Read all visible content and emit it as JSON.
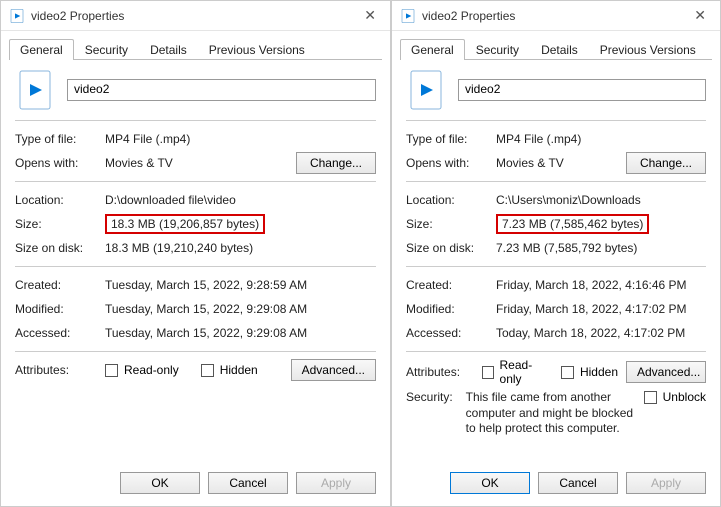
{
  "left": {
    "title": "video2 Properties",
    "tabs": [
      "General",
      "Security",
      "Details",
      "Previous Versions"
    ],
    "filename": "video2",
    "typeLbl": "Type of file:",
    "typeVal": "MP4 File (.mp4)",
    "opensLbl": "Opens with:",
    "opensVal": "Movies & TV",
    "changeBtn": "Change...",
    "locLbl": "Location:",
    "locVal": "D:\\downloaded file\\video",
    "sizeLbl": "Size:",
    "sizeVal": "18.3 MB (19,206,857 bytes)",
    "diskLbl": "Size on disk:",
    "diskVal": "18.3 MB (19,210,240 bytes)",
    "createdLbl": "Created:",
    "createdVal": "Tuesday, March 15, 2022, 9:28:59 AM",
    "modLbl": "Modified:",
    "modVal": "Tuesday, March 15, 2022, 9:29:08 AM",
    "accLbl": "Accessed:",
    "accVal": "Tuesday, March 15, 2022, 9:29:08 AM",
    "attrLbl": "Attributes:",
    "ro": "Read-only",
    "hidden": "Hidden",
    "advBtn": "Advanced...",
    "ok": "OK",
    "cancel": "Cancel",
    "apply": "Apply"
  },
  "right": {
    "title": "video2 Properties",
    "tabs": [
      "General",
      "Security",
      "Details",
      "Previous Versions"
    ],
    "filename": "video2",
    "typeLbl": "Type of file:",
    "typeVal": "MP4 File (.mp4)",
    "opensLbl": "Opens with:",
    "opensVal": "Movies & TV",
    "changeBtn": "Change...",
    "locLbl": "Location:",
    "locVal": "C:\\Users\\moniz\\Downloads",
    "sizeLbl": "Size:",
    "sizeVal": "7.23 MB (7,585,462 bytes)",
    "diskLbl": "Size on disk:",
    "diskVal": "7.23 MB (7,585,792 bytes)",
    "createdLbl": "Created:",
    "createdVal": "Friday, March 18, 2022, 4:16:46 PM",
    "modLbl": "Modified:",
    "modVal": "Friday, March 18, 2022, 4:17:02 PM",
    "accLbl": "Accessed:",
    "accVal": "Today, March 18, 2022, 4:17:02 PM",
    "attrLbl": "Attributes:",
    "ro": "Read-only",
    "hidden": "Hidden",
    "advBtn": "Advanced...",
    "secLbl": "Security:",
    "secNote": "This file came from another computer and might be blocked to help protect this computer.",
    "unblock": "Unblock",
    "ok": "OK",
    "cancel": "Cancel",
    "apply": "Apply"
  }
}
